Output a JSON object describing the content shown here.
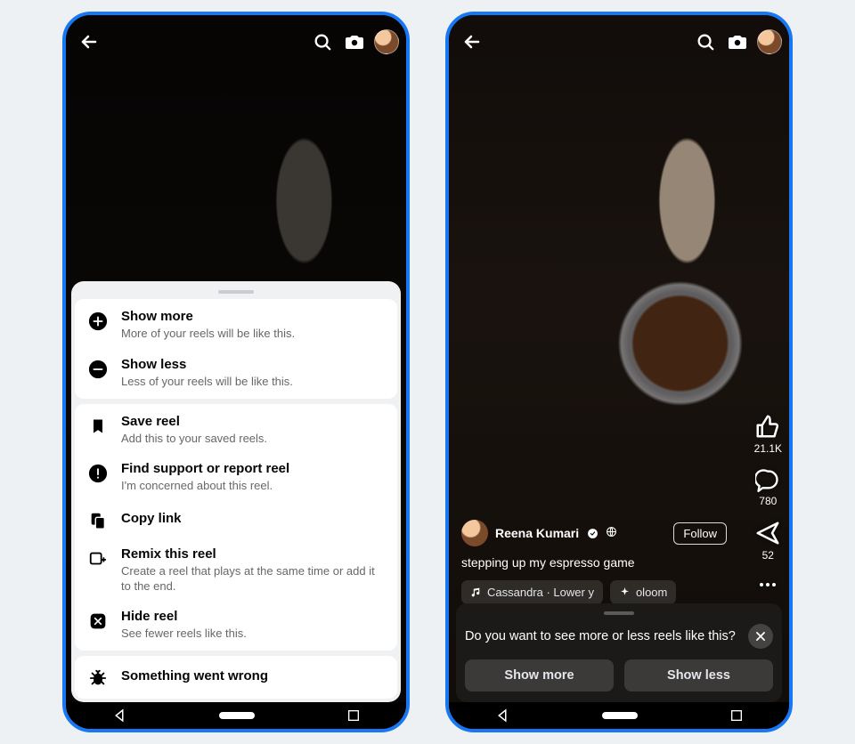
{
  "sheet": {
    "group1": [
      {
        "title": "Show more",
        "sub": "More of your reels will be like this."
      },
      {
        "title": "Show less",
        "sub": "Less of your reels will be like this."
      }
    ],
    "group2": [
      {
        "title": "Save reel",
        "sub": "Add this to your saved reels."
      },
      {
        "title": "Find support or report reel",
        "sub": "I'm concerned about this reel."
      },
      {
        "title": "Copy link",
        "sub": ""
      },
      {
        "title": "Remix this reel",
        "sub": "Create a reel that plays at the same time or add it to the end."
      },
      {
        "title": "Hide reel",
        "sub": "See fewer reels like this."
      }
    ],
    "group3": [
      {
        "title": "Something went wrong",
        "sub": ""
      }
    ]
  },
  "reel": {
    "author": "Reena Kumari",
    "follow": "Follow",
    "caption": "stepping up my espresso game",
    "music_chip": "Cassandra · Lower y",
    "effect_chip": "oloom",
    "likes": "21.1K",
    "comments": "780",
    "shares": "52"
  },
  "prompt": {
    "question": "Do you want to see more or less reels like this?",
    "more": "Show more",
    "less": "Show less"
  }
}
